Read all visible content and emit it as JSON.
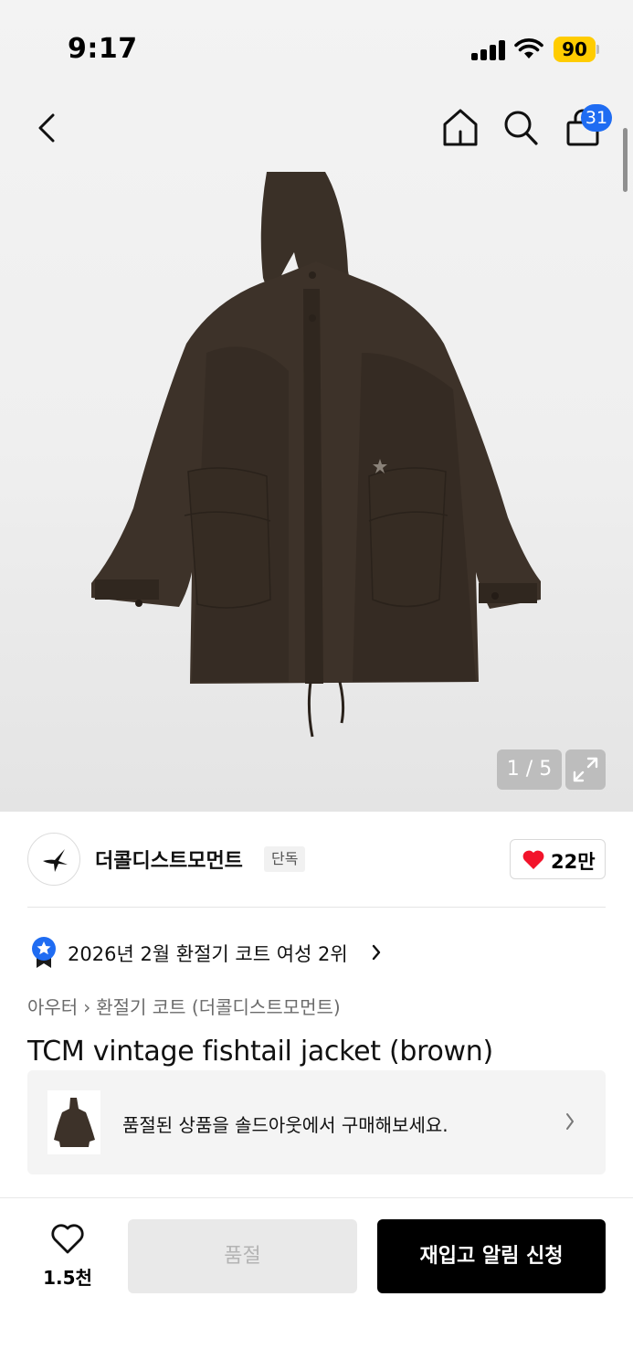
{
  "status_bar": {
    "time": "9:17",
    "battery": "90"
  },
  "nav": {
    "cart_count": "31"
  },
  "gallery": {
    "pager": "1 / 5"
  },
  "brand": {
    "name": "더콜디스트모먼트",
    "tag": "단독",
    "likes": "22만"
  },
  "ranking": {
    "text": "2026년 2월 환절기 코트 여성 2위"
  },
  "breadcrumb": {
    "category": "아우터",
    "subcategory": "환절기 코트 (더콜디스트모먼트)"
  },
  "product": {
    "title": "TCM vintage fishtail jacket (brown)"
  },
  "soldout_banner": {
    "text": "품절된 상품을 솔드아웃에서 구매해보세요."
  },
  "bottom_bar": {
    "wish_count": "1.5천",
    "soldout_label": "품절",
    "restock_label": "재입고 알림 신청"
  },
  "colors": {
    "accent_blue": "#1f6cf2",
    "heart_red": "#f2142b",
    "battery_yellow": "#ffcc00",
    "jacket_brown": "#3a3027"
  }
}
